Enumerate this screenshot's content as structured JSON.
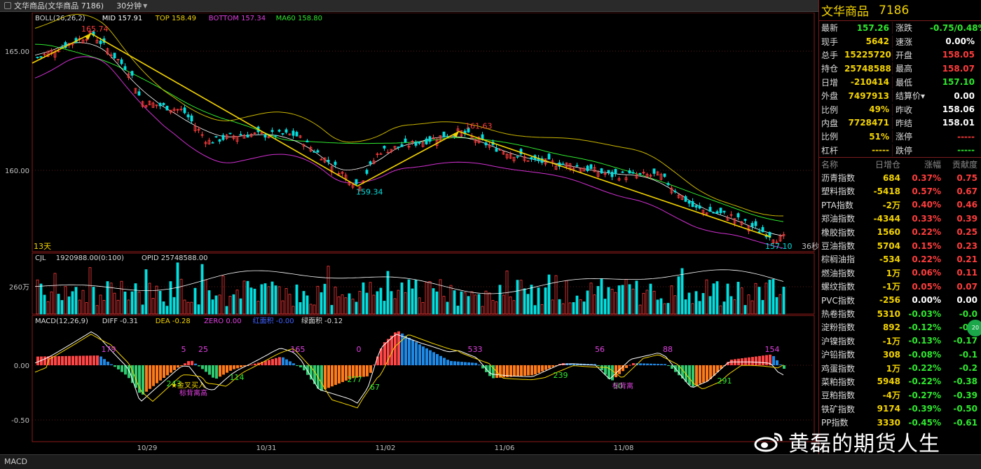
{
  "window": {
    "title": "文华商品(文华商品  7186)",
    "period": "30分钟",
    "controls": [
      "–",
      "□",
      "×"
    ]
  },
  "main_chart": {
    "indicator_line": [
      {
        "text": "BOLL(26,26,2)",
        "color": "#dddddd"
      },
      {
        "text": "MID 157.91",
        "color": "#ffffff"
      },
      {
        "text": "TOP 158.49",
        "color": "#f4d400"
      },
      {
        "text": "BOTTOM 157.34",
        "color": "#e040e0"
      },
      {
        "text": "MA60 158.80",
        "color": "#2ee82e"
      }
    ],
    "y_labels": [
      "165.00",
      "160.00"
    ],
    "annotations": {
      "high": "165.74",
      "low": "159.34",
      "mid_high": "161.63",
      "last": "157.10"
    },
    "corner_left": "13天",
    "corner_right": "36秒"
  },
  "volume_chart": {
    "indicator_line": [
      {
        "text": "CJL",
        "color": "#dddddd"
      },
      {
        "text": "1920988.00(0:100)",
        "color": "#dddddd"
      },
      {
        "text": "OPID 25748588.00",
        "color": "#dddddd"
      }
    ],
    "y_label": "260万"
  },
  "macd_chart": {
    "indicator_line": [
      {
        "text": "MACD(12,26,9)",
        "color": "#dddddd"
      },
      {
        "text": "DIFF -0.31",
        "color": "#dddddd"
      },
      {
        "text": "DEA -0.28",
        "color": "#f4d400"
      },
      {
        "text": "ZERO 0.00",
        "color": "#e040e0"
      },
      {
        "text": "红面积 -0.00",
        "color": "#4060ff"
      },
      {
        "text": "绿面积 -0.12",
        "color": "#dddddd"
      }
    ],
    "y_labels": [
      "0.00",
      "-0.50"
    ],
    "positive_labels": [
      "179",
      "5",
      "25",
      "165",
      "0",
      "533",
      "56",
      "88",
      "154"
    ],
    "negative_labels": [
      "243",
      "114",
      "277",
      "67",
      "239",
      "50",
      "291"
    ],
    "notes": [
      "★金叉买入",
      "标背离高",
      "标背离"
    ]
  },
  "x_labels": [
    "10/29",
    "10/31",
    "11/02",
    "11/06",
    "11/08"
  ],
  "bottom_tab": "MACD",
  "quote": {
    "name": "文华商品",
    "code": "7186",
    "rows": [
      {
        "l1": "最新",
        "v1": "157.26",
        "c1": "dn",
        "l2": "涨跌",
        "v2": "-0.75/0.48%",
        "c2": "dn"
      },
      {
        "l1": "现手",
        "v1": "5642",
        "c1": "ye",
        "l2": "速涨",
        "v2": "0.00%",
        "c2": "wh"
      },
      {
        "l1": "总手",
        "v1": "15225720",
        "c1": "ye",
        "l2": "开盘",
        "v2": "158.05",
        "c2": "up"
      },
      {
        "l1": "持仓",
        "v1": "25748588",
        "c1": "ye",
        "l2": "最高",
        "v2": "158.07",
        "c2": "up"
      },
      {
        "l1": "日增",
        "v1": "-210414",
        "c1": "ye",
        "l2": "最低",
        "v2": "157.10",
        "c2": "dn"
      },
      {
        "l1": "外盘",
        "v1": "7497913",
        "c1": "ye",
        "l2": "结算价▾",
        "v2": "0.00",
        "c2": "wh"
      },
      {
        "l1": "比例",
        "v1": "49%",
        "c1": "ye",
        "l2": "昨收",
        "v2": "158.06",
        "c2": "wh"
      },
      {
        "l1": "内盘",
        "v1": "7728471",
        "c1": "ye",
        "l2": "昨结",
        "v2": "158.01",
        "c2": "wh"
      },
      {
        "l1": "比例",
        "v1": "51%",
        "c1": "ye",
        "l2": "涨停",
        "v2": "-----",
        "c2": "up"
      },
      {
        "l1": "杠杆",
        "v1": "-----",
        "c1": "ye",
        "l2": "跌停",
        "v2": "-----",
        "c2": "dn"
      }
    ]
  },
  "index_table": {
    "headers": [
      "名称",
      "日增仓",
      "涨幅",
      "贡献度"
    ],
    "rows": [
      {
        "name": "沥青指数",
        "inc": "684",
        "chg": "0.37%",
        "contrib": "0.75",
        "dir": "up"
      },
      {
        "name": "塑料指数",
        "inc": "-5418",
        "chg": "0.57%",
        "contrib": "0.67",
        "dir": "up"
      },
      {
        "name": "PTA指数",
        "inc": "-2万",
        "chg": "0.40%",
        "contrib": "0.46",
        "dir": "up"
      },
      {
        "name": "郑油指数",
        "inc": "-4344",
        "chg": "0.33%",
        "contrib": "0.39",
        "dir": "up"
      },
      {
        "name": "橡胶指数",
        "inc": "1560",
        "chg": "0.22%",
        "contrib": "0.25",
        "dir": "up"
      },
      {
        "name": "豆油指数",
        "inc": "5704",
        "chg": "0.15%",
        "contrib": "0.23",
        "dir": "up"
      },
      {
        "name": "棕榈油指",
        "inc": "-534",
        "chg": "0.22%",
        "contrib": "0.21",
        "dir": "up"
      },
      {
        "name": "燃油指数",
        "inc": "1万",
        "chg": "0.06%",
        "contrib": "0.11",
        "dir": "up"
      },
      {
        "name": "螺纹指数",
        "inc": "-1万",
        "chg": "0.05%",
        "contrib": "0.07",
        "dir": "up"
      },
      {
        "name": "PVC指数",
        "inc": "-256",
        "chg": "0.00%",
        "contrib": "0.00",
        "dir": "wh"
      },
      {
        "name": "热卷指数",
        "inc": "5310",
        "chg": "-0.03%",
        "contrib": "-0.0",
        "dir": "dn"
      },
      {
        "name": "淀粉指数",
        "inc": "892",
        "chg": "-0.12%",
        "contrib": "-0.1",
        "dir": "dn"
      },
      {
        "name": "沪镍指数",
        "inc": "-1万",
        "chg": "-0.13%",
        "contrib": "-0.17",
        "dir": "dn"
      },
      {
        "name": "沪铅指数",
        "inc": "308",
        "chg": "-0.08%",
        "contrib": "-0.1",
        "dir": "dn"
      },
      {
        "name": "鸡蛋指数",
        "inc": "1万",
        "chg": "-0.22%",
        "contrib": "-0.2",
        "dir": "dn"
      },
      {
        "name": "菜粕指数",
        "inc": "5948",
        "chg": "-0.22%",
        "contrib": "-0.38",
        "dir": "dn"
      },
      {
        "name": "豆粕指数",
        "inc": "-4万",
        "chg": "-0.27%",
        "contrib": "-0.39",
        "dir": "dn"
      },
      {
        "name": "铁矿指数",
        "inc": "9174",
        "chg": "-0.39%",
        "contrib": "-0.50",
        "dir": "dn"
      },
      {
        "name": "PP指数",
        "inc": "3330",
        "chg": "-0.45%",
        "contrib": "-0.61",
        "dir": "dn"
      }
    ]
  },
  "watermark": "黄磊的期货人生",
  "edge_badge": "20"
}
